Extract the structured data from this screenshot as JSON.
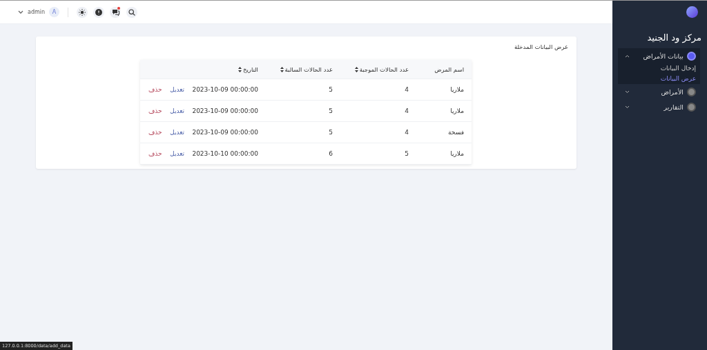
{
  "header": {
    "user": "admin",
    "avatar": "A",
    "notification_dot": true
  },
  "sidebar": {
    "title": "مركز ود الجنيد",
    "items": [
      {
        "label": "بيانات الأمراض",
        "expanded": true,
        "selected": true,
        "children": [
          {
            "label": "إدخال البيانات",
            "selected": false
          },
          {
            "label": "عرض البيانات",
            "selected": true
          }
        ]
      },
      {
        "label": "الأمراض",
        "expanded": false,
        "selected": false
      },
      {
        "label": "التقارير",
        "expanded": false,
        "selected": false
      }
    ]
  },
  "card": {
    "title": "عرض البيانات المدخلة"
  },
  "table": {
    "columns": [
      {
        "label": "اسم المرض",
        "sortable": false
      },
      {
        "label": "عدد الحالات الموجبة",
        "sortable": true
      },
      {
        "label": "عدد الحالات السالبة",
        "sortable": true
      },
      {
        "label": "التاريخ",
        "sortable": true
      }
    ],
    "rows": [
      {
        "disease": "ملاريا",
        "positive": "4",
        "negative": "5",
        "date": "2023-10-09 00:00:00",
        "edit": "تعديل",
        "delete": "حذف"
      },
      {
        "disease": "ملاريا",
        "positive": "4",
        "negative": "5",
        "date": "2023-10-09 00:00:00",
        "edit": "تعديل",
        "delete": "حذف"
      },
      {
        "disease": "فسحة",
        "positive": "4",
        "negative": "5",
        "date": "2023-10-09 00:00:00",
        "edit": "تعديل",
        "delete": "حذف"
      },
      {
        "disease": "ملاريا",
        "positive": "5",
        "negative": "6",
        "date": "2023-10-10 00:00:00",
        "edit": "تعديل",
        "delete": "حذف"
      }
    ]
  },
  "status_bar": {
    "url": "127.0.0.1:8000/data/add_data"
  }
}
